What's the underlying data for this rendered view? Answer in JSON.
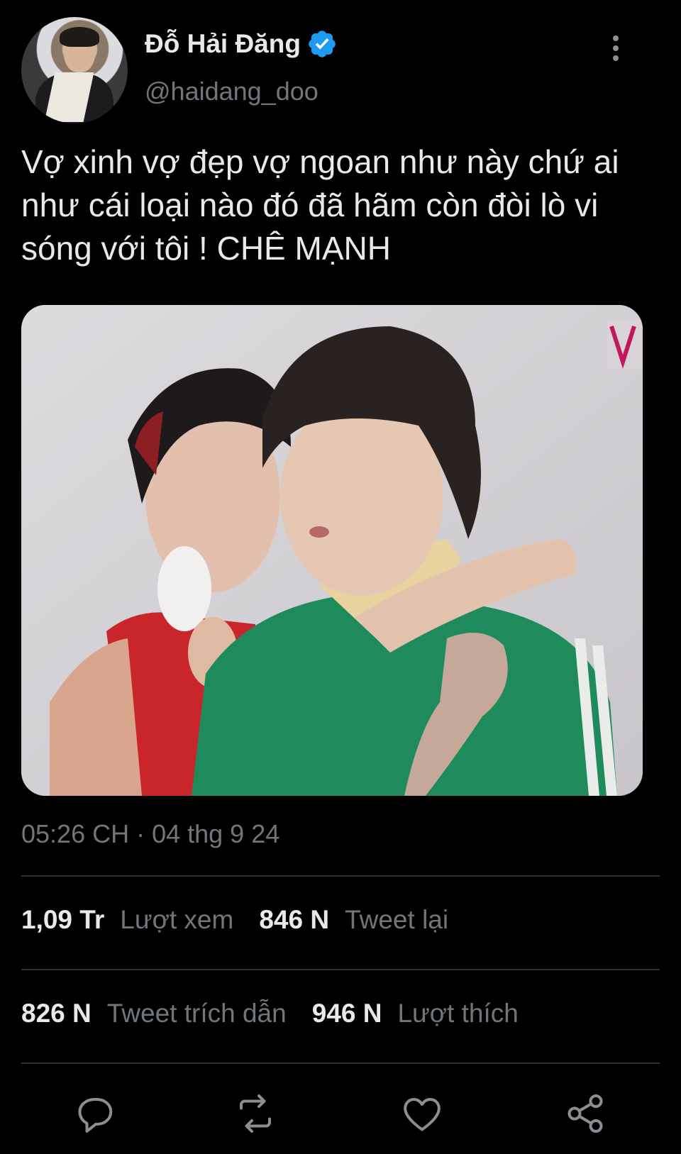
{
  "author": {
    "display_name": "Đỗ Hải Đăng",
    "handle": "@haidang_doo",
    "verified": true
  },
  "tweet": {
    "text": "Vợ xinh vợ đẹp vợ ngoan như này chứ ai như cái loại nào đó đã hãm còn đòi lò vi sóng với tôi ! CHÊ MẠNH",
    "timestamp": "05:26 CH · 04 thg 9 24"
  },
  "stats": {
    "views_count": "1,09 Tr",
    "views_label": "Lượt xem",
    "retweets_count": "846 N",
    "retweets_label": "Tweet lại",
    "quotes_count": "826 N",
    "quotes_label": "Tweet trích dẫn",
    "likes_count": "946 N",
    "likes_label": "Lượt thích"
  },
  "icons": {
    "more": "more-vertical-icon",
    "reply": "reply-icon",
    "retweet": "retweet-icon",
    "like": "heart-icon",
    "share": "share-icon",
    "verified": "verified-badge-icon"
  },
  "colors": {
    "background": "#000000",
    "text": "#e7e9ea",
    "secondary": "#71767b",
    "verified": "#1d9bf0",
    "divider": "#2f3336"
  }
}
